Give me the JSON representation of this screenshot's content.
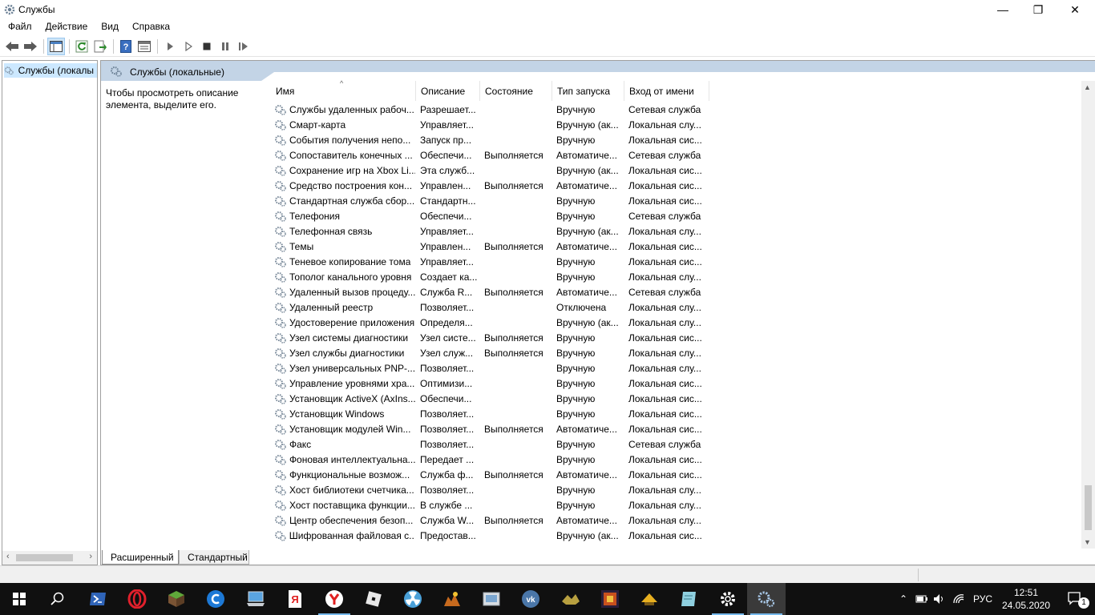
{
  "window": {
    "title": "Службы",
    "controls": {
      "minimize": "—",
      "maximize": "❐",
      "close": "✕"
    }
  },
  "menu": [
    "Файл",
    "Действие",
    "Вид",
    "Справка"
  ],
  "toolbar": {
    "buttons": [
      "back-icon",
      "forward-icon",
      "show-console-tree-icon",
      "refresh-icon",
      "export-list-icon",
      "help-icon",
      "properties-icon",
      "start-icon",
      "start-alt-icon",
      "stop-icon",
      "pause-icon",
      "resume-icon"
    ]
  },
  "tree": {
    "root_label": "Службы (локалы"
  },
  "panel": {
    "title": "Службы (локальные)",
    "hint": "Чтобы просмотреть описание элемента, выделите его."
  },
  "table": {
    "columns": [
      "Имя",
      "Описание",
      "Состояние",
      "Тип запуска",
      "Вход от имени"
    ],
    "sort_indicator": "^",
    "rows": [
      [
        "Службы удаленных рабоч...",
        "Разрешает...",
        "",
        "Вручную",
        "Сетевая служба"
      ],
      [
        "Смарт-карта",
        "Управляет...",
        "",
        "Вручную (ак...",
        "Локальная слу..."
      ],
      [
        "События получения непо...",
        "Запуск пр...",
        "",
        "Вручную",
        "Локальная сис..."
      ],
      [
        "Сопоставитель конечных ...",
        "Обеспечи...",
        "Выполняется",
        "Автоматиче...",
        "Сетевая служба"
      ],
      [
        "Сохранение игр на Xbox Li...",
        "Эта служб...",
        "",
        "Вручную (ак...",
        "Локальная сис..."
      ],
      [
        "Средство построения кон...",
        "Управлен...",
        "Выполняется",
        "Автоматиче...",
        "Локальная сис..."
      ],
      [
        "Стандартная служба сбор...",
        "Стандартн...",
        "",
        "Вручную",
        "Локальная сис..."
      ],
      [
        "Телефония",
        "Обеспечи...",
        "",
        "Вручную",
        "Сетевая служба"
      ],
      [
        "Телефонная связь",
        "Управляет...",
        "",
        "Вручную (ак...",
        "Локальная слу..."
      ],
      [
        "Темы",
        "Управлен...",
        "Выполняется",
        "Автоматиче...",
        "Локальная сис..."
      ],
      [
        "Теневое копирование тома",
        "Управляет...",
        "",
        "Вручную",
        "Локальная сис..."
      ],
      [
        "Тополог канального уровня",
        "Создает ка...",
        "",
        "Вручную",
        "Локальная слу..."
      ],
      [
        "Удаленный вызов процеду...",
        "Служба R...",
        "Выполняется",
        "Автоматиче...",
        "Сетевая служба"
      ],
      [
        "Удаленный реестр",
        "Позволяет...",
        "",
        "Отключена",
        "Локальная слу..."
      ],
      [
        "Удостоверение приложения",
        "Определя...",
        "",
        "Вручную (ак...",
        "Локальная слу..."
      ],
      [
        "Узел системы диагностики",
        "Узел систе...",
        "Выполняется",
        "Вручную",
        "Локальная сис..."
      ],
      [
        "Узел службы диагностики",
        "Узел служ...",
        "Выполняется",
        "Вручную",
        "Локальная слу..."
      ],
      [
        "Узел универсальных PNP-...",
        "Позволяет...",
        "",
        "Вручную",
        "Локальная слу..."
      ],
      [
        "Управление уровнями хра...",
        "Оптимизи...",
        "",
        "Вручную",
        "Локальная сис..."
      ],
      [
        "Установщик ActiveX (AxIns...",
        "Обеспечи...",
        "",
        "Вручную",
        "Локальная сис..."
      ],
      [
        "Установщик Windows",
        "Позволяет...",
        "",
        "Вручную",
        "Локальная сис..."
      ],
      [
        "Установщик модулей Win...",
        "Позволяет...",
        "Выполняется",
        "Автоматиче...",
        "Локальная сис..."
      ],
      [
        "Факс",
        "Позволяет...",
        "",
        "Вручную",
        "Сетевая служба"
      ],
      [
        "Фоновая интеллектуальна...",
        "Передает ...",
        "",
        "Вручную",
        "Локальная сис..."
      ],
      [
        "Функциональные возмож...",
        "Служба ф...",
        "Выполняется",
        "Автоматиче...",
        "Локальная сис..."
      ],
      [
        "Хост библиотеки счетчика...",
        "Позволяет...",
        "",
        "Вручную",
        "Локальная слу..."
      ],
      [
        "Хост поставщика функции...",
        "В службе ...",
        "",
        "Вручную",
        "Локальная слу..."
      ],
      [
        "Центр обеспечения безоп...",
        "Служба W...",
        "Выполняется",
        "Автоматиче...",
        "Локальная слу..."
      ],
      [
        "Шифрованная файловая с...",
        "Предостав...",
        "",
        "Вручную (ак...",
        "Локальная сис..."
      ]
    ]
  },
  "tabs": [
    "Расширенный",
    "Стандартный"
  ],
  "taskbar": {
    "apps": [
      "start-icon",
      "search-icon",
      "powershell-icon",
      "opera-icon",
      "minecraft-icon",
      "ccleaner-icon",
      "computer-icon",
      "yandex-browser-icon",
      "yandex-icon",
      "roblox-icon",
      "radiation-icon",
      "game-icon",
      "explorer-icon",
      "vk-icon",
      "game2-icon",
      "game3-icon",
      "game4-icon",
      "notepad-icon",
      "settings-icon",
      "services-icon"
    ],
    "tray": {
      "language": "РУС",
      "time": "12:51",
      "date": "24.05.2020",
      "notifications": "1"
    }
  },
  "colors": {
    "accent": "#0078d7",
    "selection": "#cce8ff",
    "band": "#d8e3ed"
  }
}
